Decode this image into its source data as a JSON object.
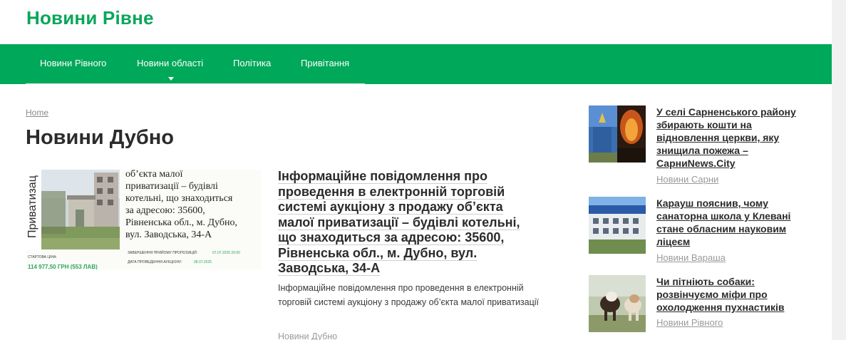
{
  "site": {
    "title": "Новини Рівне"
  },
  "nav": {
    "items": [
      {
        "label": "Новини Рівного"
      },
      {
        "label": "Новини області"
      },
      {
        "label": "Політика"
      },
      {
        "label": "Привітання"
      }
    ]
  },
  "breadcrumb": {
    "home": "Home"
  },
  "page": {
    "title": "Новини Дубно"
  },
  "main_article": {
    "title": "Інформаційне повідомлення про проведення в електронній торговій системі аукціону з продажу об’єкта малої приватизації – будівлі котельні, що знаходиться за адресою: 35600, Рівненська обл., м. Дубно, вул. Заводська, 34-А",
    "excerpt": "Інформаційне повідомлення про проведення в електронній торговій системі аукціону з продажу об’єкта малої приватизації",
    "category": "Новини Дубно",
    "thumb": {
      "vertical_label": "Приватизац",
      "line1": "об’єкта малої",
      "line2": "приватизації – будівлі",
      "line3": "котельні, що знаходиться",
      "line4": "за адресою: 35600,",
      "line5": "Рівненська обл., м. Дубно,",
      "line6": "вул. Заводська, 34-А",
      "start_price_label": "СТАРТОВА ЦІНА:",
      "start_price": "114 977,50 ГРН (553 ЛАВ)",
      "deadline_label": "ЗАВЕРШЕННЯ ПРИЙОМУ ПРОПОЗИЦІЙ:",
      "deadline": "07.07.2025 20:00",
      "auction_date_label": "ДАТА ПРОВЕДЕННЯ АУКЦІОНУ:",
      "auction_date": "08.07.2025"
    }
  },
  "sidebar": {
    "items": [
      {
        "title": "У селі Сарненського району збирають кошти на відновлення церкви, яку знищила пожежа – СарниNews.City",
        "category": "Новини Сарни"
      },
      {
        "title": "Карауш пояснив, чому санаторна школа у Клевані стане обласним науковим ліцеєм",
        "category": "Новини Вараша"
      },
      {
        "title": "Чи пітніють собаки: розвінчуємо міфи про охолодження пухнастиків",
        "category": "Новини Рівного"
      }
    ]
  },
  "colors": {
    "brand_green": "#00a85a",
    "title_green": "#0aa65a",
    "text_dark": "#2b2b2b",
    "muted": "#9a9a9a"
  }
}
